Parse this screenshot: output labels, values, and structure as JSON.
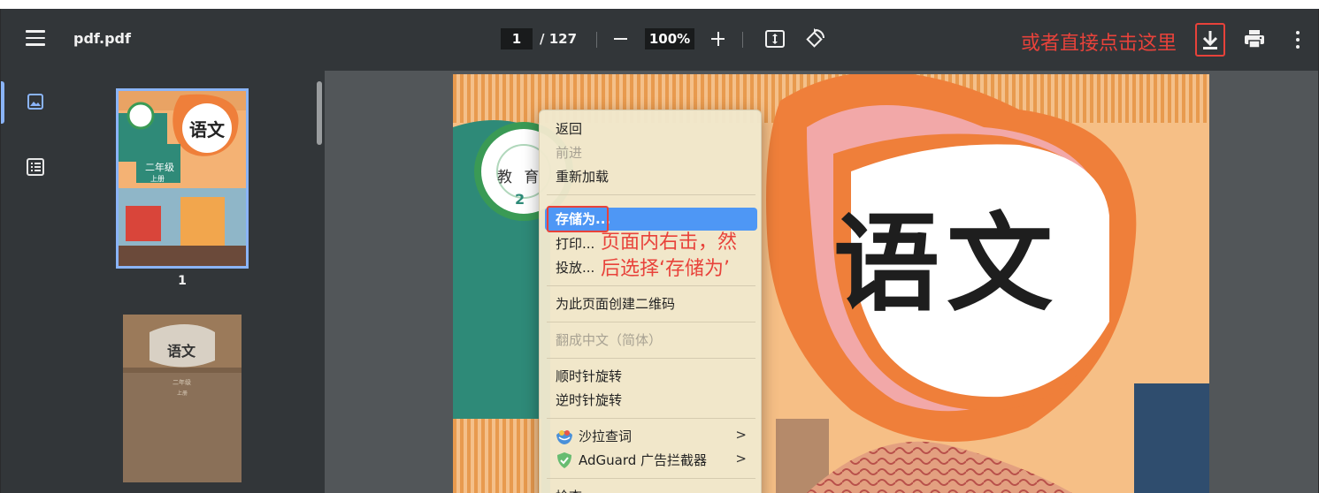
{
  "toolbar": {
    "title": "pdf.pdf",
    "page_current": "1",
    "page_total": "/ 127",
    "zoom": "100%",
    "annotation": "或者直接点击这里",
    "icons": [
      "menu-icon",
      "zoom-out-icon",
      "zoom-in-icon",
      "fit-page-icon",
      "rotate-icon",
      "download-icon",
      "print-icon",
      "more-vert-icon"
    ]
  },
  "sidebar": {
    "thumbnails": [
      {
        "label": "1",
        "cover_title": "语文",
        "grade": "二年级",
        "volume": "上册"
      },
      {
        "label": "",
        "cover_title": "语文",
        "grade": "二年级",
        "volume": "上册"
      }
    ]
  },
  "page": {
    "title_art": "语文",
    "badge_text": "教 育",
    "badge_num": "2"
  },
  "context_menu": {
    "items": [
      {
        "label": "返回",
        "disabled": false
      },
      {
        "label": "前进",
        "disabled": true
      },
      {
        "label": "重新加载",
        "disabled": false
      },
      {
        "label": "存储为...",
        "disabled": false,
        "highlighted": true
      },
      {
        "label": "打印...",
        "disabled": false
      },
      {
        "label": "投放...",
        "disabled": false
      },
      {
        "label": "为此页面创建二维码",
        "disabled": false
      },
      {
        "label": "翻成中文（简体）",
        "disabled": true
      },
      {
        "label": "顺时针旋转",
        "disabled": false
      },
      {
        "label": "逆时针旋转",
        "disabled": false
      },
      {
        "label": "沙拉查词",
        "disabled": false,
        "submenu": true,
        "icon": "saladict-icon"
      },
      {
        "label": "AdGuard 广告拦截器",
        "disabled": false,
        "submenu": true,
        "icon": "adguard-shield-icon"
      },
      {
        "label": "检查",
        "disabled": false
      }
    ],
    "annotation_line1": "页面内右击，然",
    "annotation_line2": "后选择‘存储为’"
  },
  "colors": {
    "annotation": "#e8423a",
    "highlight": "#4e97f5",
    "toolbar": "#323639",
    "accent": "#8ab4f8"
  }
}
